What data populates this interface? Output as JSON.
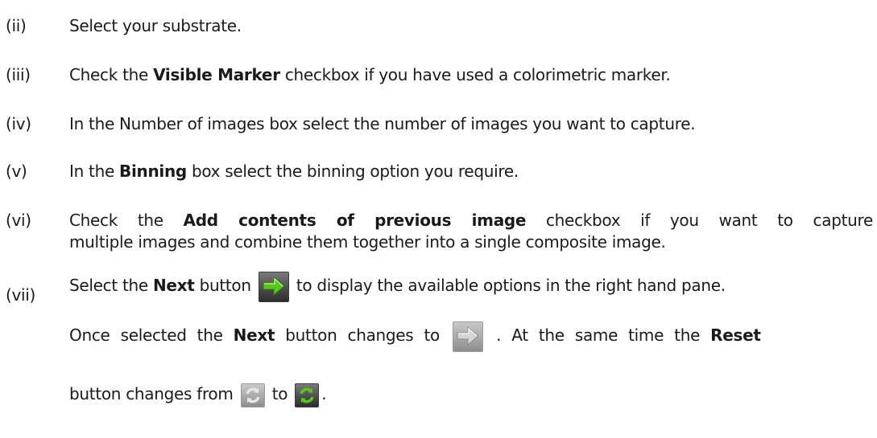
{
  "steps": [
    {
      "num": "(ii)",
      "text": "Select your substrate."
    },
    {
      "num": "(iii)",
      "pre": "Check the ",
      "bold": "Visible Marker",
      "post": " checkbox if you have used a colorimetric marker."
    },
    {
      "num": "(iv)",
      "text": "In the Number of images box select the number of images you want to capture."
    },
    {
      "num": "(v)",
      "pre": "In the ",
      "bold": "Binning",
      "post": " box select the binning option you require."
    },
    {
      "num": "(vi)",
      "line1_pre": "Check the ",
      "line1_bold": "Add contents of previous image",
      "line1_post": " checkbox if you want to capture",
      "line2": "multiple images and combine them together into a single composite image."
    },
    {
      "num": "(vii)",
      "l1_a": "Select the ",
      "l1_b": "Next",
      "l1_c": " button",
      "l1_d": "to display the available options in the right hand pane.",
      "l2_a": "Once selected the ",
      "l2_b": "Next",
      "l2_c": " button changes to",
      "l2_d": ". At the same time the ",
      "l2_e": "Reset",
      "l3_a": "button changes from",
      "l3_b": "to",
      "l3_c": "."
    }
  ],
  "icons": {
    "next_active": "green-right-arrow-icon",
    "next_inactive": "grey-right-arrow-icon",
    "reset_inactive": "grey-refresh-icon",
    "reset_active": "green-refresh-icon"
  },
  "colors": {
    "text": "#1a1a1a",
    "green_icon": "#52c41a",
    "grey_icon": "#bdbdbd"
  }
}
